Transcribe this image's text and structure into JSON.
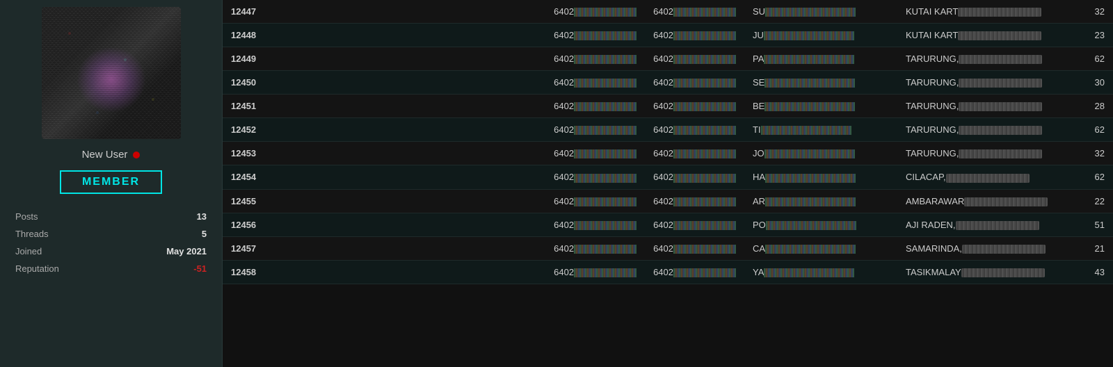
{
  "sidebar": {
    "username": "New User",
    "online": true,
    "badge": "MEMBER",
    "stats": [
      {
        "label": "Posts",
        "value": "13",
        "class": ""
      },
      {
        "label": "Threads",
        "value": "5",
        "class": ""
      },
      {
        "label": "Joined",
        "value": "May 2021",
        "class": ""
      },
      {
        "label": "Reputation",
        "value": "-51",
        "class": "reputation-value"
      }
    ]
  },
  "table": {
    "rows": [
      {
        "num": "12447",
        "code1": "6402",
        "code2": "6402",
        "nameStart": "SU",
        "location": "KUTAI KART",
        "count": 32
      },
      {
        "num": "12448",
        "code1": "6402",
        "code2": "6402",
        "nameStart": "JU",
        "location": "KUTAI KART",
        "count": 23
      },
      {
        "num": "12449",
        "code1": "6402",
        "code2": "6402",
        "nameStart": "PA",
        "location": "TARURUNG,",
        "count": 62
      },
      {
        "num": "12450",
        "code1": "6402",
        "code2": "6402",
        "nameStart": "SE",
        "location": "TARURUNG,",
        "count": 30
      },
      {
        "num": "12451",
        "code1": "6402",
        "code2": "6402",
        "nameStart": "BE",
        "location": "TARURUNG,",
        "count": 28
      },
      {
        "num": "12452",
        "code1": "6402",
        "code2": "6402",
        "nameStart": "TI",
        "location": "TARURUNG,",
        "count": 62
      },
      {
        "num": "12453",
        "code1": "6402",
        "code2": "6402",
        "nameStart": "JO",
        "location": "TARURUNG,",
        "count": 32
      },
      {
        "num": "12454",
        "code1": "6402",
        "code2": "6402",
        "nameStart": "HA",
        "location": "CILACAP,",
        "count": 62
      },
      {
        "num": "12455",
        "code1": "6402",
        "code2": "6402",
        "nameStart": "AR",
        "location": "AMBARAWAR",
        "count": 22
      },
      {
        "num": "12456",
        "code1": "6402",
        "code2": "6402",
        "nameStart": "PO",
        "location": "AJI RADEN,",
        "count": 51
      },
      {
        "num": "12457",
        "code1": "6402",
        "code2": "6402",
        "nameStart": "CA",
        "location": "SAMARINDA,",
        "count": 21
      },
      {
        "num": "12458",
        "code1": "6402",
        "code2": "6402",
        "nameStart": "YA",
        "location": "TASIKMALAY",
        "count": 43
      }
    ]
  }
}
